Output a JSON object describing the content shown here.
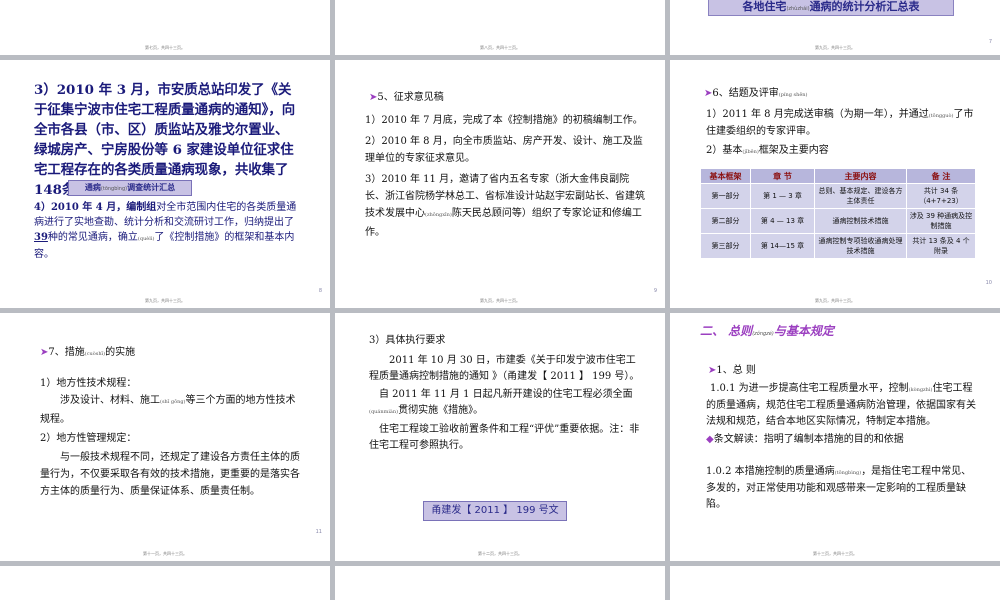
{
  "slides": {
    "s1": {
      "footer": "第七页，共四十三页。"
    },
    "s2": {
      "footer": "第八页，共四十三页。"
    },
    "s3": {
      "banner_a": "各地住宅",
      "banner_ruby": "(zhùzhái)",
      "banner_b": "通病的统计分析汇总表",
      "footer": "第九页，共四十三页。",
      "page": "7"
    },
    "s4": {
      "item3": "3）2010 年 3 月，市安质总站印发了《关于征集宁波市住宅工程质量通病的通知》，向全市各县（市、区）质监站及雅戈尔置业、绿城房产、宁房股份等 6 家建设单位征求住宅工程存在的各类质量通病现象，共收集了148条各类质量通病。",
      "box_a": "通病",
      "box_ruby": "(tōngbìng)",
      "box_b": "调查统计汇总",
      "item4_num": "4）",
      "item4_a": "2010 年 4 月，编制组",
      "item4_b": "对全市范围内住宅的各类质量通病进行了实地查勘、统计分析和交流研讨工作，归纳提出了",
      "item4_num39": "39",
      "item4_c": "种的常见通病，确立",
      "item4_ruby": "(quèlì)",
      "item4_d": "了《控制措施》的框架和基本内容。",
      "footer": "第九页，共四十三页。",
      "page": "8"
    },
    "s5": {
      "head": "5、征求意见稿",
      "p1": "1）2010 年 7 月底，完成了本《控制措施》的初稿编制工作。",
      "p2": "2）2010 年 8 月，向全市质监站、房产开发、设计、施工及监理单位的专家征求意见。",
      "p3a": "3）2010 年 11 月，邀请了省内五名专家（浙大金伟良副院长、浙江省院杨学林总工、省标准设计站赵宇宏副站长、省建筑技术发展中心",
      "p3ruby": "(zhōngxīn)",
      "p3b": "陈天民总顾问等）组织了专家论证和修编工作。",
      "footer": "第九页，共四十三页。",
      "page": "9"
    },
    "s6": {
      "head": "6、结题及评审",
      "head_ruby": "(píng shěn)",
      "p1a": "1）2011 年 8 月完成送审稿（为期一年），并通过",
      "p1ruby": "(tōngguò)",
      "p1b": "了市住建委组织的专家评审。",
      "p2a": "2）基本",
      "p2ruby": "(jīběn)",
      "p2b": "框架及主要内容",
      "table": {
        "headers": [
          "基本框架",
          "章  节",
          "主要内容",
          "备  注"
        ],
        "rows": [
          [
            "第一部分",
            "第 1 — 3 章",
            "总则、基本规定、建设各方主体责任",
            "共计 34 条（4+7+23）"
          ],
          [
            "第二部分",
            "第 4 — 13 章",
            "通病控制技术措施",
            "涉及 39 种通病及控制措施"
          ],
          [
            "第三部分",
            "第 14—15 章",
            "通病控制专项验收通病处理技术措施",
            "共计 13 条及 4 个附录"
          ]
        ]
      },
      "footer": "第九页，共四十三页。",
      "page": "10"
    },
    "s7": {
      "head_a": "7、措施",
      "head_ruby": "(cuòshī)",
      "head_b": "的实施",
      "p1": "1）地方性技术规程：",
      "p2a": "涉及设计、材料、施工",
      "p2ruby": "(shī gōng)",
      "p2b": "等三个方面的地方性技术规程。",
      "p3": "2）地方性管理规定：",
      "p4": "与一般技术规程不同，还规定了建设各方责任主体的质量行为，不仅要采取各有效的技术措施，更重要的是落实各方主体的质量行为、质量保证体系、质量责任制。",
      "footer": "第十一页，共四十三页。",
      "page": "11"
    },
    "s8": {
      "p1": "3）具体执行要求",
      "p2": "2011 年 10 月 30 日，市建委《关于印发宁波市住宅工程质量通病控制措施的通知 》（甬建发【 2011 】 199 号）。",
      "p3a": "自 2011 年 11 月 1 日起凡新开建设的住宅工程必须全面",
      "p3ruby": "(quánmiàn)",
      "p3b": "贯彻实施《措施》。",
      "p4": "住宅工程竣工验收前置条件和工程“评优”重要依据。注：非住宅工程可参照执行。",
      "ref": "甬建发【 2011 】 199 号文",
      "footer": "第十二页，共四十三页。"
    },
    "s9": {
      "title_a": "二、  总则",
      "title_ruby": "(zǒngzé)",
      "title_b": "与基本规定",
      "sub": "1、总  则",
      "p1a": "1.0.1  为进一步提高住宅工程质量水平，控制",
      "p1ruby": "(kòngzhì)",
      "p1b": "住宅工程的质量通病，规范住宅工程质量通病防治管理，依据国家有关法规和规范，结合本地区实际情况，特制定本措施。",
      "note": "条文解读：指明了编制本措施的目的和依据",
      "p2a": "1.0.2  本措施控制的质量通病",
      "p2ruby": "(tōngbìng)",
      "p2b": "，是指住宅工程中常见、多发的，对正常使用功能和观感带来一定影响的工程质量缺陷。",
      "footer": "第十三页，共四十三页。"
    }
  }
}
